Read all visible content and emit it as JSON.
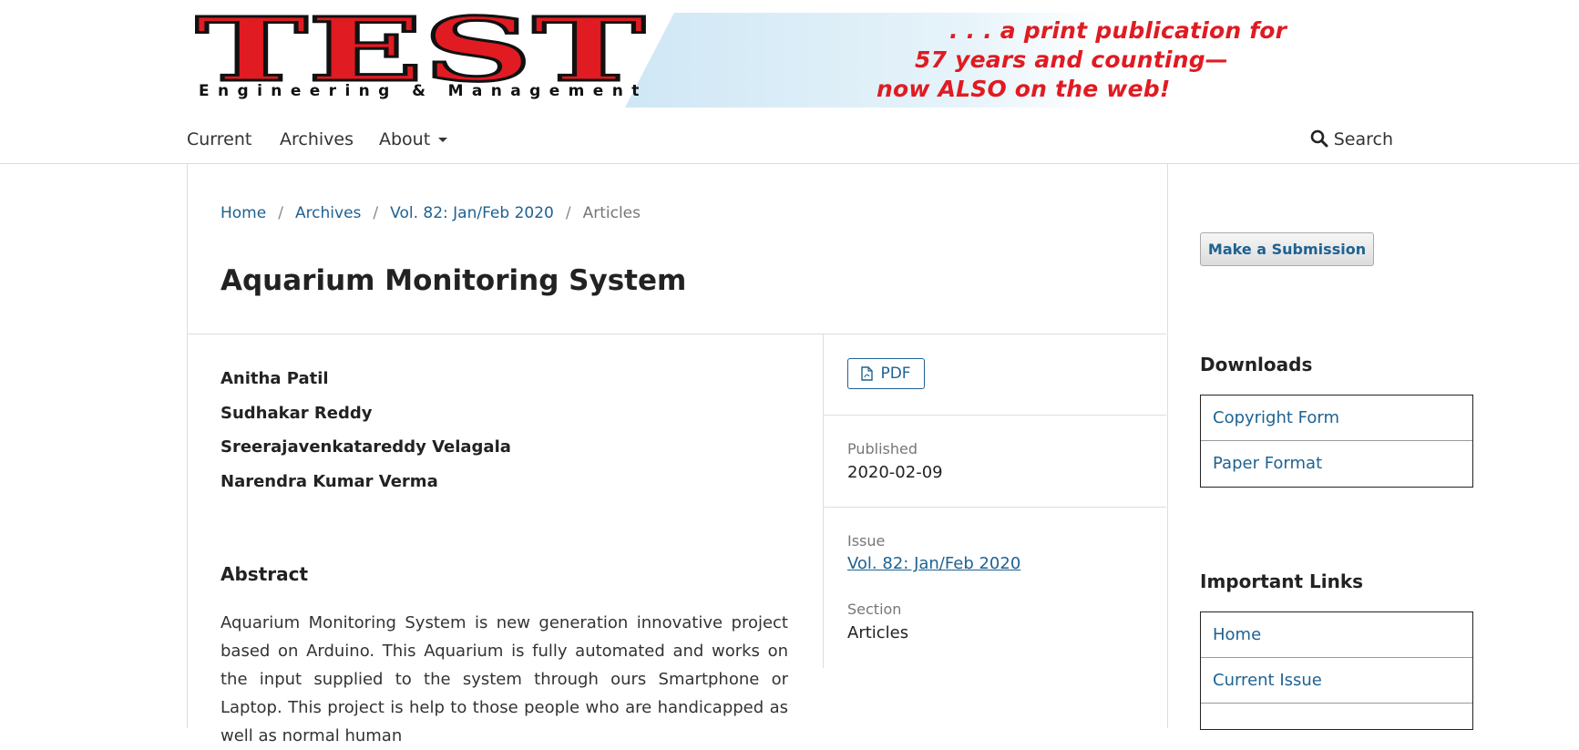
{
  "banner": {
    "logo_text": "TEST",
    "subtitle": "Engineering & Management",
    "tagline": [
      ". . . a print publication for",
      "57 years and counting—",
      "now ALSO on the web!"
    ]
  },
  "nav": {
    "items": [
      {
        "label": "Current"
      },
      {
        "label": "Archives"
      },
      {
        "label": "About"
      }
    ],
    "search_label": "Search"
  },
  "breadcrumb": {
    "items": [
      "Home",
      "Archives",
      "Vol. 82: Jan/Feb 2020"
    ],
    "current": "Articles",
    "separator": "/"
  },
  "article": {
    "title": "Aquarium Monitoring System",
    "authors": [
      "Anitha Patil",
      "Sudhakar Reddy",
      "Sreerajavenkatareddy Velagala",
      "Narendra Kumar Verma"
    ],
    "abstract_heading": "Abstract",
    "abstract": "Aquarium Monitoring System is new generation innovative project based on Arduino. This Aquarium is fully automated and works on the input supplied to the system through ours Smartphone or Laptop. This project is help to those people who are handicapped as well as normal human"
  },
  "details": {
    "pdf_label": "PDF",
    "published_label": "Published",
    "published_value": "2020-02-09",
    "issue_label": "Issue",
    "issue_value": "Vol. 82: Jan/Feb 2020",
    "section_label": "Section",
    "section_value": "Articles"
  },
  "sidebar": {
    "submit_label": "Make a Submission",
    "downloads_heading": "Downloads",
    "downloads": [
      "Copyright Form",
      "Paper Format"
    ],
    "links_heading": "Important Links",
    "links": [
      "Home",
      "Current Issue",
      ""
    ]
  },
  "colors": {
    "link": "#1e6292",
    "logo_red": "#e01b22",
    "banner_blue": "#d6ecf7"
  }
}
